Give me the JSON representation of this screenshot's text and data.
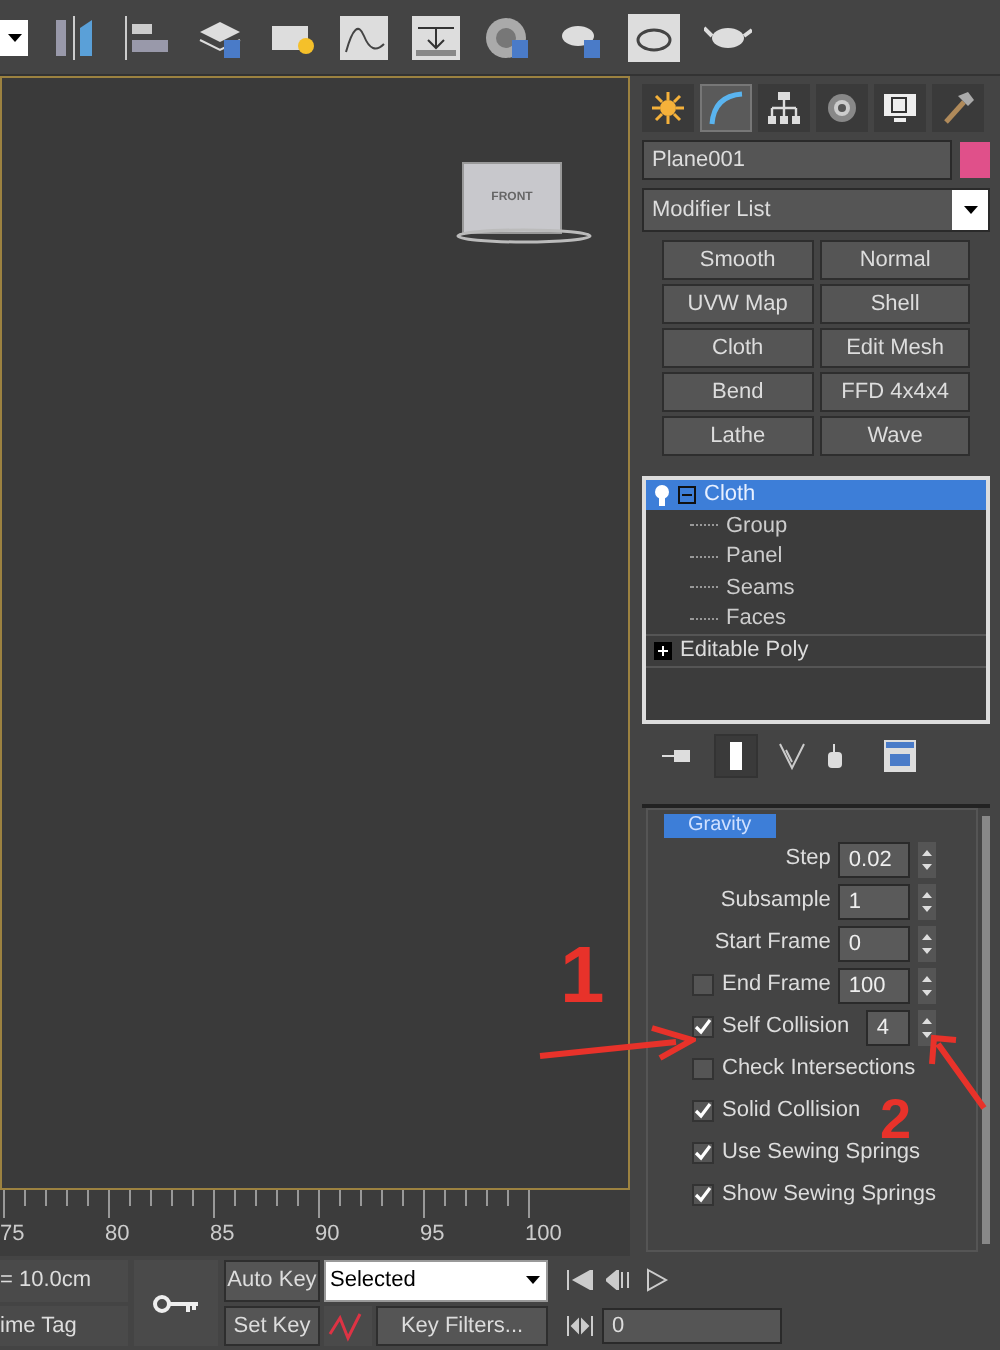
{
  "command_panel": {
    "tabs": [
      {
        "kind": "create",
        "selected": false
      },
      {
        "kind": "modify",
        "selected": true
      },
      {
        "kind": "hierarchy",
        "selected": false
      },
      {
        "kind": "motion",
        "selected": false
      },
      {
        "kind": "display",
        "selected": false
      },
      {
        "kind": "utilities",
        "selected": false
      }
    ],
    "object": {
      "name": "Plane001",
      "color": "#e0508a"
    },
    "modifier_list": "Modifier List",
    "modifier_buttons": [
      "Smooth",
      "Normal",
      "UVW Map",
      "Shell",
      "Cloth",
      "Edit Mesh",
      "Bend",
      "FFD 4x4x4",
      "Lathe",
      "Wave"
    ],
    "stack": [
      {
        "label": "Cloth",
        "selected": true,
        "expanded": true,
        "children": [
          {
            "label": "Group"
          },
          {
            "label": "Panel"
          },
          {
            "label": "Seams"
          },
          {
            "label": "Faces"
          }
        ]
      },
      {
        "label": "Editable Poly",
        "selected": false,
        "expanded": false
      }
    ],
    "rollout": [
      {
        "kind": "toggle",
        "label": "Gravity",
        "selected": true
      },
      {
        "kind": "spinner",
        "label": "Step",
        "value": "0.02"
      },
      {
        "kind": "spinner",
        "label": "Subsample",
        "value": "1"
      },
      {
        "kind": "spinner",
        "label": "Start Frame",
        "value": "0"
      },
      {
        "kind": "check_spinner",
        "label": "End Frame",
        "checked": false,
        "value": "100"
      },
      {
        "kind": "check_spinner",
        "label": "Self Collision",
        "checked": true,
        "value": "4"
      },
      {
        "kind": "check",
        "label": "Check Intersections",
        "checked": false
      },
      {
        "kind": "check",
        "label": "Solid Collision",
        "checked": true
      },
      {
        "kind": "check",
        "label": "Use Sewing Springs",
        "checked": true
      },
      {
        "kind": "check",
        "label": "Show Sewing Springs",
        "checked": true
      }
    ]
  },
  "viewcube": {
    "label": "FRONT"
  },
  "timeline": {
    "ticks": [
      "75",
      "80",
      "85",
      "90",
      "95",
      "100"
    ]
  },
  "status": {
    "grid": "= 10.0cm",
    "time_tag": "ime Tag",
    "auto_key": "Auto Key",
    "set_key": "Set Key",
    "key_mode": "Selected",
    "key_filters": "Key Filters...",
    "frame": "0"
  },
  "annotations": [
    {
      "label": "1"
    },
    {
      "label": "2"
    }
  ]
}
